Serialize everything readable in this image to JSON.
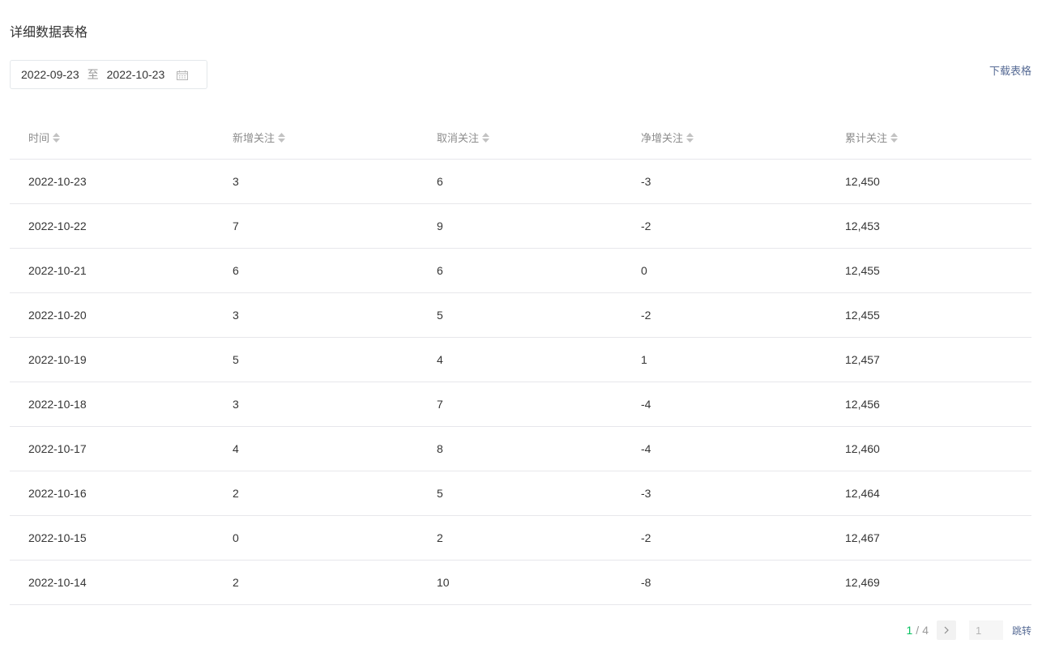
{
  "section_title": "详细数据表格",
  "date_range": {
    "start": "2022-09-23",
    "separator": "至",
    "end": "2022-10-23",
    "icon": "calendar-icon"
  },
  "download_label": "下载表格",
  "table": {
    "headers": [
      "时间",
      "新增关注",
      "取消关注",
      "净增关注",
      "累计关注"
    ],
    "rows": [
      [
        "2022-10-23",
        "3",
        "6",
        "-3",
        "12,450"
      ],
      [
        "2022-10-22",
        "7",
        "9",
        "-2",
        "12,453"
      ],
      [
        "2022-10-21",
        "6",
        "6",
        "0",
        "12,455"
      ],
      [
        "2022-10-20",
        "3",
        "5",
        "-2",
        "12,455"
      ],
      [
        "2022-10-19",
        "5",
        "4",
        "1",
        "12,457"
      ],
      [
        "2022-10-18",
        "3",
        "7",
        "-4",
        "12,456"
      ],
      [
        "2022-10-17",
        "4",
        "8",
        "-4",
        "12,460"
      ],
      [
        "2022-10-16",
        "2",
        "5",
        "-3",
        "12,464"
      ],
      [
        "2022-10-15",
        "0",
        "2",
        "-2",
        "12,467"
      ],
      [
        "2022-10-14",
        "2",
        "10",
        "-8",
        "12,469"
      ]
    ]
  },
  "pagination": {
    "current": "1",
    "separator": "/",
    "total": "4",
    "input_value": "1",
    "jump_label": "跳转"
  },
  "colors": {
    "accent_green": "#07c160",
    "link_blue": "#576b95",
    "border": "#e7e7eb"
  }
}
